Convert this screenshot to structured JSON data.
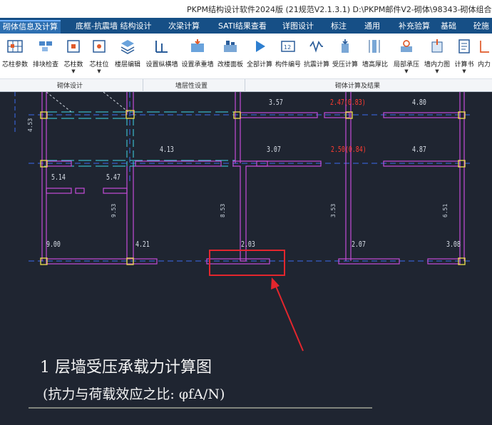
{
  "window": {
    "title": "PKPM结构设计软件2024版 (21规范V2.1.3.1) D:\\PKPM邮件V2-砌体\\98343-砌体组合柱"
  },
  "tabs": [
    {
      "label": "砌体信息及计算",
      "active": true
    },
    {
      "label": "底框-抗震墙 结构设计"
    },
    {
      "label": "次梁计算"
    },
    {
      "label": "SATI结果查看"
    },
    {
      "label": "详图设计"
    },
    {
      "label": "标注"
    },
    {
      "label": "通用"
    },
    {
      "label": "补充验算"
    },
    {
      "label": "基础"
    },
    {
      "label": "砼施"
    }
  ],
  "ribbon": {
    "buttons": [
      {
        "label": "芯柱参数",
        "icon": "grid-columns-icon"
      },
      {
        "label": "排块检查",
        "icon": "block-check-icon"
      },
      {
        "label": "芯柱数",
        "icon": "core-count-icon",
        "dropdown": true
      },
      {
        "label": "芯柱位",
        "icon": "core-position-icon",
        "dropdown": true
      },
      {
        "label": "楼层编辑",
        "icon": "floor-edit-icon"
      },
      {
        "label": "设置纵横墙",
        "icon": "wall-set-icon"
      },
      {
        "label": "设置承重墙",
        "icon": "bearing-wall-icon"
      },
      {
        "label": "改楼面板",
        "icon": "floor-slab-icon"
      },
      {
        "label": "全部计算",
        "icon": "run-all-icon"
      },
      {
        "label": "构件编号",
        "icon": "member-number-icon"
      },
      {
        "label": "抗震计算",
        "icon": "seismic-calc-icon"
      },
      {
        "label": "受压计算",
        "icon": "compression-calc-icon"
      },
      {
        "label": "墙高厚比",
        "icon": "wall-ratio-icon"
      },
      {
        "label": "局部承压",
        "icon": "local-bearing-icon",
        "dropdown": true
      },
      {
        "label": "墙内力图",
        "icon": "wall-force-icon",
        "dropdown": true
      },
      {
        "label": "计算书",
        "icon": "calc-book-icon",
        "dropdown": true
      },
      {
        "label": "内力",
        "icon": "force-icon"
      }
    ],
    "groups": [
      "砌体设计",
      "墙层性设置",
      "砌体计算及结果"
    ]
  },
  "drawing": {
    "values": [
      {
        "text": "3.57",
        "color": "white"
      },
      {
        "text": "2.47(0.83)",
        "color": "red"
      },
      {
        "text": "4.80",
        "color": "white"
      },
      {
        "text": "4.13",
        "color": "white"
      },
      {
        "text": "3.07",
        "color": "white"
      },
      {
        "text": "2.50(0.84)",
        "color": "red"
      },
      {
        "text": "4.87",
        "color": "white"
      },
      {
        "text": "5.14",
        "color": "white"
      },
      {
        "text": "5.47",
        "color": "white"
      },
      {
        "text": "9.00",
        "color": "white"
      },
      {
        "text": "4.21",
        "color": "white"
      },
      {
        "text": "2.03",
        "color": "white"
      },
      {
        "text": "2.07",
        "color": "white"
      },
      {
        "text": "3.08",
        "color": "white"
      }
    ],
    "vertical_values": [
      "4.53",
      "9.53",
      "8.53",
      "3.53",
      "6.51"
    ],
    "caption_line1": "1   层墙受压承载力计算图",
    "caption_line2": "(抗力与荷载效应之比: φfA/N)",
    "highlight_color": "#e3262d",
    "wall_color": "#c54cd8",
    "axis_color": "#3b6cf0",
    "node_color": "#f0e14a"
  }
}
